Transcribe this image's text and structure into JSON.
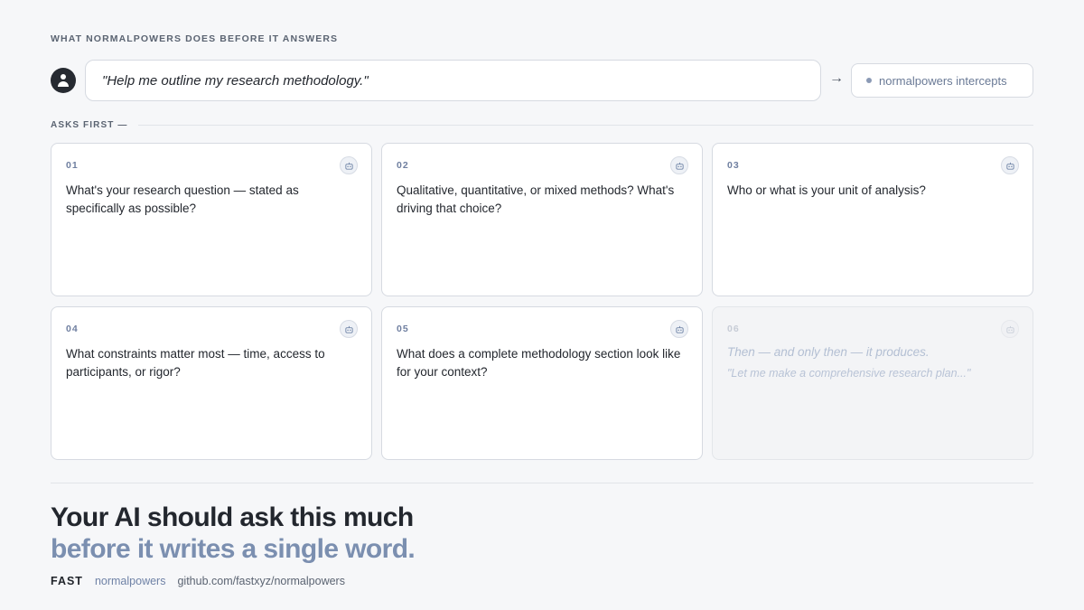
{
  "eyebrow": "WHAT NORMALPOWERS DOES BEFORE IT ANSWERS",
  "prompt": {
    "avatar_icon": "user-icon",
    "text": "\"Help me outline my research methodology.\"",
    "arrow": "→",
    "intercept_label": "normalpowers intercepts"
  },
  "section_label": "ASKS FIRST —",
  "cards": [
    {
      "num": "01",
      "icon": "robot-icon",
      "text": "What's your research question — stated as specifically as possible?"
    },
    {
      "num": "02",
      "icon": "robot-icon",
      "text": "Qualitative, quantitative, or mixed methods? What's driving that choice?"
    },
    {
      "num": "03",
      "icon": "robot-icon",
      "text": "Who or what is your unit of analysis?"
    },
    {
      "num": "04",
      "icon": "robot-icon",
      "text": "What constraints matter most — time, access to participants, or rigor?"
    },
    {
      "num": "05",
      "icon": "robot-icon",
      "text": "What does a complete methodology section look like for your context?"
    }
  ],
  "final_card": {
    "num": "06",
    "icon": "robot-icon",
    "line1": "Then — and only then — it produces.",
    "line2": "\"Let me make a comprehensive research plan...\""
  },
  "headline": {
    "line1": "Your AI should ask this much",
    "line2": "before it writes a single word."
  },
  "footer": {
    "brand": "FAST",
    "product": "normalpowers",
    "repo": "github.com/fastxyz/normalpowers"
  },
  "colors": {
    "accent": "#7b8fb0",
    "background": "#f6f7f9",
    "text": "#23272e"
  }
}
